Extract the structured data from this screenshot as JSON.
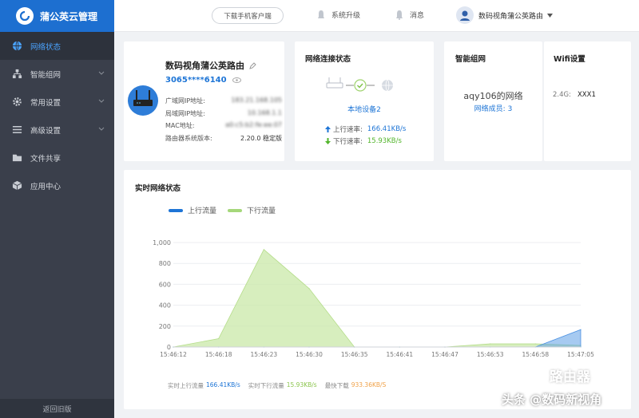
{
  "app": {
    "title": "蒲公英云管理"
  },
  "sidebar": {
    "items": [
      {
        "label": "网络状态",
        "icon": "globe-icon",
        "active": true
      },
      {
        "label": "智能组网",
        "icon": "network-icon",
        "expandable": true
      },
      {
        "label": "常用设置",
        "icon": "gear-icon",
        "expandable": true
      },
      {
        "label": "高级设置",
        "icon": "list-icon",
        "expandable": true
      },
      {
        "label": "文件共享",
        "icon": "folder-icon"
      },
      {
        "label": "应用中心",
        "icon": "cube-icon"
      }
    ],
    "old_version": "返回旧版"
  },
  "topbar": {
    "download": "下载手机客户端",
    "upgrade": "系统升级",
    "messages": "消息",
    "user": "数码视角蒲公英路由"
  },
  "router": {
    "name": "数码视角蒲公英路由",
    "id": "3065****6140",
    "wan_label": "广域网IP地址:",
    "wan_value": "183.21.168.105",
    "lan_label": "局域网IP地址:",
    "lan_value": "10.168.1.1",
    "mac_label": "MAC地址:",
    "mac_value": "a0:c5:b2:fe:ee:07",
    "fw_label": "路由器系统版本:",
    "fw_value": "2.20.0 稳定版"
  },
  "connection": {
    "title": "网络连接状态",
    "local": "本地设备2",
    "up_label": "上行速率:",
    "up_value": "166.41KB/s",
    "down_label": "下行速率:",
    "down_value": "15.93KB/s"
  },
  "mesh": {
    "title": "智能组网",
    "network": "aqy106的网络",
    "members_label": "网络成员:",
    "members": "3"
  },
  "wifi": {
    "title": "Wifi设置",
    "band": "2.4G:",
    "ssid": "XXX1"
  },
  "realtime": {
    "title": "实时网络状态",
    "up_total_label": "实时上行流量",
    "up_total": "166.41KB/s",
    "down_total_label": "实时下行流量",
    "down_total": "15.93KB/s",
    "max_label": "最快下载",
    "max_value": "933.36KB/S"
  },
  "colors": {
    "accent": "#1d6fd0",
    "up": "#1e75d6",
    "down": "#a5d77a"
  },
  "chart_data": {
    "type": "area",
    "x": [
      "15:46:12",
      "15:46:18",
      "15:46:23",
      "15:46:30",
      "15:46:35",
      "15:46:41",
      "15:46:47",
      "15:46:53",
      "15:46:58",
      "15:47:05"
    ],
    "series": [
      {
        "name": "上行流量",
        "values": [
          0,
          0,
          0,
          0,
          0,
          0,
          0,
          0,
          0,
          166
        ]
      },
      {
        "name": "下行流量",
        "values": [
          0,
          80,
          933,
          560,
          0,
          0,
          0,
          30,
          30,
          15
        ]
      }
    ],
    "yticks": [
      "0",
      "200",
      "400",
      "600",
      "800",
      "1,000"
    ],
    "ylim": [
      0,
      1000
    ],
    "legend": "top-left",
    "grid": true
  },
  "watermark": {
    "text": "头条 @数码新视角",
    "badge": "路由器"
  }
}
